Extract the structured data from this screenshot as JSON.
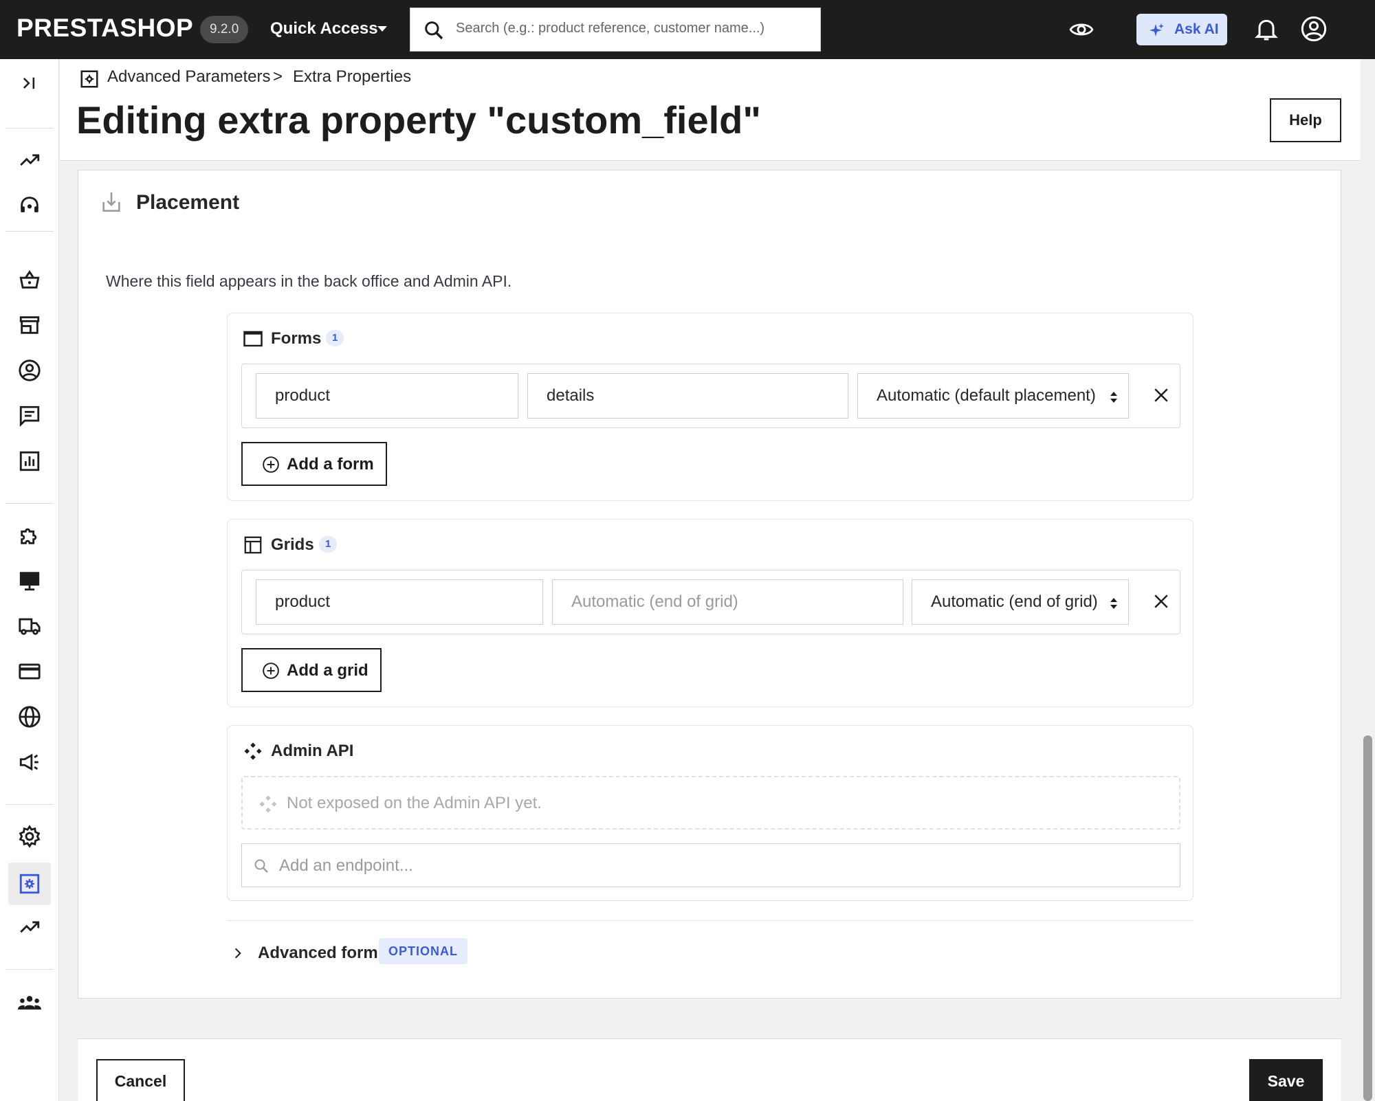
{
  "topbar": {
    "logo": "PRESTASHOP",
    "version": "9.2.0",
    "quick_access_label": "Quick Access",
    "search_placeholder": "Search (e.g.: product reference, customer name...)",
    "ask_ai_label": "Ask AI"
  },
  "breadcrumb": {
    "parent": "Advanced Parameters",
    "separator": ">",
    "current": "Extra Properties"
  },
  "page": {
    "title": "Editing extra property \"custom_field\"",
    "help_label": "Help"
  },
  "placement": {
    "title": "Placement",
    "description": "Where this field appears in the back office and Admin API.",
    "forms": {
      "title": "Forms",
      "count": "1",
      "row": {
        "entity": "product",
        "tab": "details",
        "position": "Automatic (default placement)"
      },
      "add_label": "Add a form"
    },
    "grids": {
      "title": "Grids",
      "count": "1",
      "row": {
        "entity": "product",
        "column_placeholder": "Automatic (end of grid)",
        "position": "Automatic (end of grid)"
      },
      "add_label": "Add a grid"
    },
    "admin_api": {
      "title": "Admin API",
      "empty_text": "Not exposed on the Admin API yet.",
      "endpoint_placeholder": "Add an endpoint..."
    },
    "advanced": {
      "title": "Advanced form",
      "badge": "OPTIONAL"
    }
  },
  "footer": {
    "cancel_label": "Cancel",
    "save_label": "Save"
  },
  "colors": {
    "topbar_bg": "#1d1d1b",
    "accent": "#3a5ad9",
    "badge_bg": "#e6ecfb"
  },
  "sidebar_icons": [
    "collapse-icon",
    "trending-icon",
    "support-icon",
    "basket-icon",
    "store-icon",
    "customer-icon",
    "messages-icon",
    "stats-icon",
    "puzzle-icon",
    "monitor-icon",
    "truck-icon",
    "credit-card-icon",
    "globe-icon",
    "megaphone-icon",
    "settings-gear-icon",
    "advanced-params-icon",
    "trending-icon",
    "team-icon"
  ]
}
